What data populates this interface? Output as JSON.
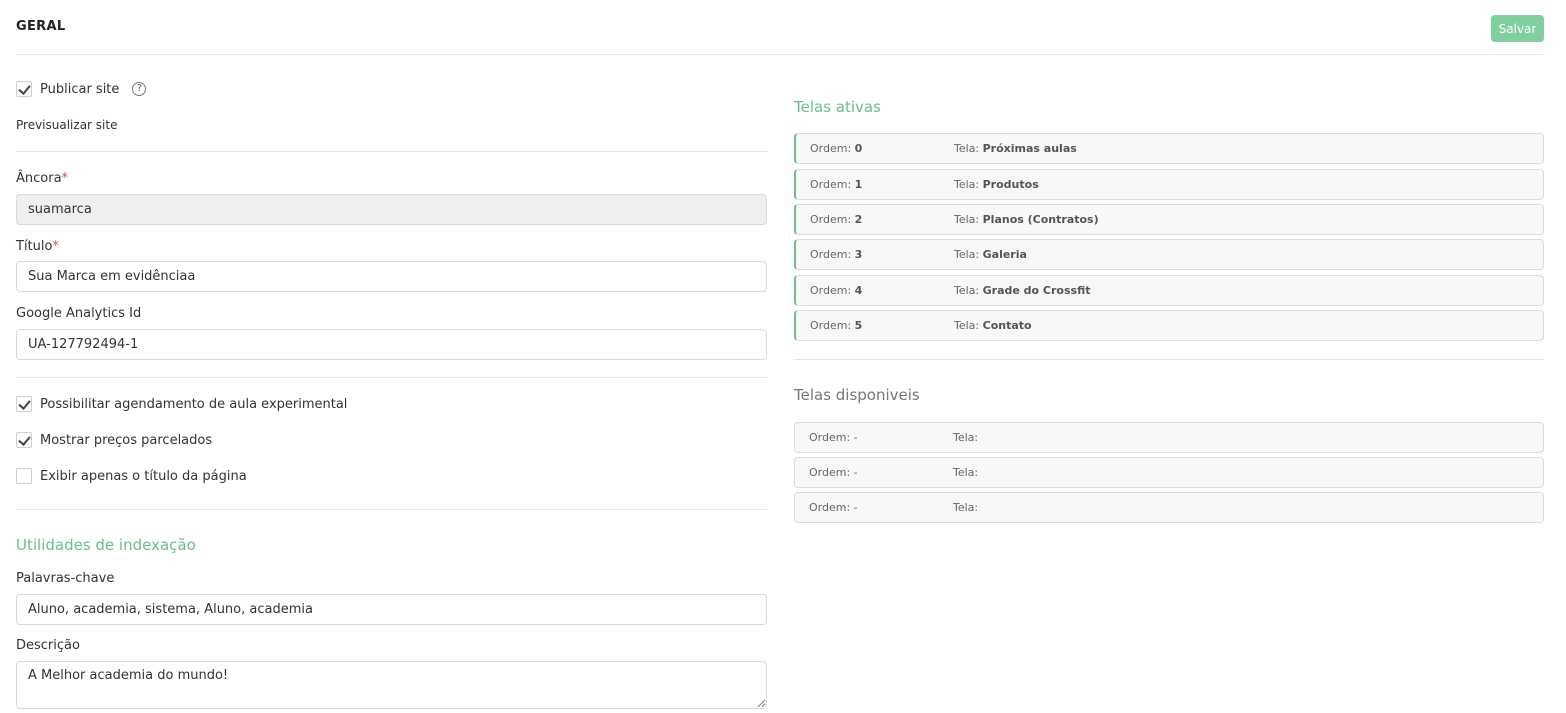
{
  "header": {
    "title": "GERAL",
    "save_label": "Salvar"
  },
  "publish": {
    "label": "Publicar site",
    "checked": true,
    "help": "?"
  },
  "preview_label": "Previsualizar site",
  "anchor": {
    "label": "Âncora",
    "required_mark": "*",
    "value": "suamarca"
  },
  "title_field": {
    "label": "Título",
    "required_mark": "*",
    "value": "Sua Marca em evidênciaa"
  },
  "analytics": {
    "label": "Google Analytics Id",
    "value": "UA-127792494-1"
  },
  "options": [
    {
      "label": "Possibilitar agendamento de aula experimental",
      "checked": true
    },
    {
      "label": "Mostrar preços parcelados",
      "checked": true
    },
    {
      "label": "Exibir apenas o título da página",
      "checked": false
    }
  ],
  "indexing": {
    "title": "Utilidades de indexação",
    "keywords": {
      "label": "Palavras-chave",
      "value": "Aluno, academia, sistema, Aluno, academia"
    },
    "description": {
      "label": "Descrição",
      "value": "A Melhor academia do mundo!"
    }
  },
  "active_screens": {
    "title": "Telas ativas",
    "order_label": "Ordem:",
    "screen_label": "Tela:",
    "items": [
      {
        "order": "0",
        "screen": "Próximas aulas"
      },
      {
        "order": "1",
        "screen": "Produtos"
      },
      {
        "order": "2",
        "screen": "Planos (Contratos)"
      },
      {
        "order": "3",
        "screen": "Galeria"
      },
      {
        "order": "4",
        "screen": "Grade do Crossfit"
      },
      {
        "order": "5",
        "screen": "Contato"
      }
    ]
  },
  "available_screens": {
    "title": "Telas disponiveis",
    "order_label": "Ordem:",
    "screen_label": "Tela:",
    "items": [
      {
        "order": "-",
        "screen": ""
      },
      {
        "order": "-",
        "screen": ""
      },
      {
        "order": "-",
        "screen": ""
      }
    ]
  },
  "colors": {
    "accent": "#6cbf8a",
    "save_button": "#7fcf9f",
    "required": "#d9534f"
  }
}
